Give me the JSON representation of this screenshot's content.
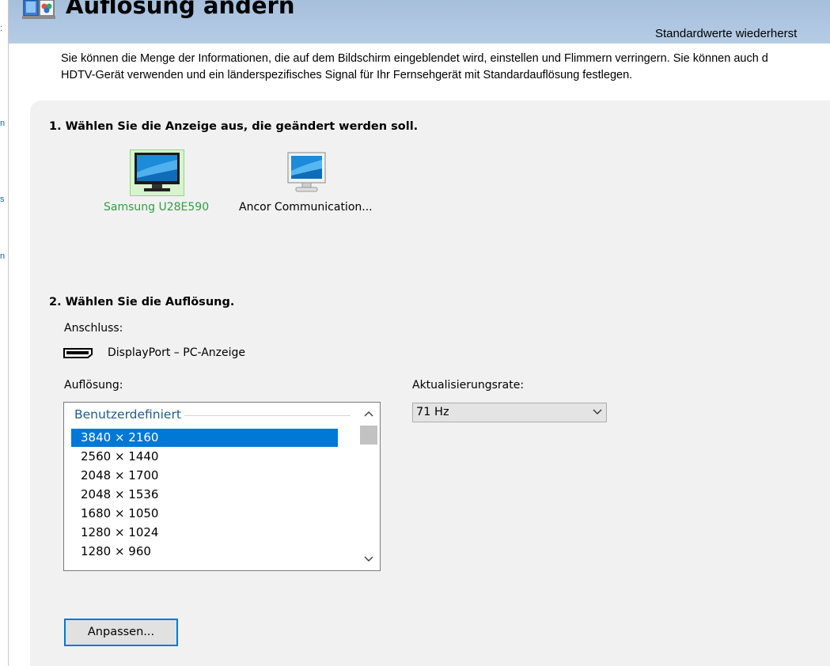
{
  "sidebar_edge": {
    "fragments": [
      ":",
      "n",
      "s",
      "n"
    ]
  },
  "header": {
    "title": "Auflösung ändern",
    "restore_link": "Standardwerte wiederherst",
    "icon": "display-settings-icon"
  },
  "description": {
    "line1": "Sie können die Menge der Informationen, die auf dem Bildschirm eingeblendet wird, einstellen und Flimmern verringern. Sie können auch d",
    "line2": "HDTV-Gerät verwenden und ein länderspezifisches Signal für Ihr Fernsehgerät mit Standardauflösung festlegen."
  },
  "step1": {
    "heading": "1. Wählen Sie die Anzeige aus, die geändert werden soll.",
    "displays": [
      {
        "label": "Samsung U28E590",
        "selected": true,
        "icon": "monitor-icon"
      },
      {
        "label": "Ancor Communication...",
        "selected": false,
        "icon": "monitor-icon"
      }
    ]
  },
  "step2": {
    "heading": "2. Wählen Sie die Auflösung.",
    "connection_label": "Anschluss:",
    "connection_value": "DisplayPort – PC-Anzeige",
    "connection_icon": "displayport-icon",
    "resolution_label": "Auflösung:",
    "resolution_group": "Benutzerdefiniert",
    "resolutions": [
      "3840 × 2160",
      "2560 × 1440",
      "2048 × 1700",
      "2048 × 1536",
      "1680 × 1050",
      "1280 × 1024",
      "1280 × 960"
    ],
    "selected_resolution": "3840 × 2160",
    "refresh_label": "Aktualisierungsrate:",
    "refresh_value": "71 Hz",
    "customize_button": "Anpassen..."
  },
  "colors": {
    "accent": "#0078d7",
    "selected_display_text": "#2ea043",
    "group_header": "#1e5a96",
    "header_bg": "#a6bfdb",
    "panel_bg": "#f1f1f1"
  }
}
